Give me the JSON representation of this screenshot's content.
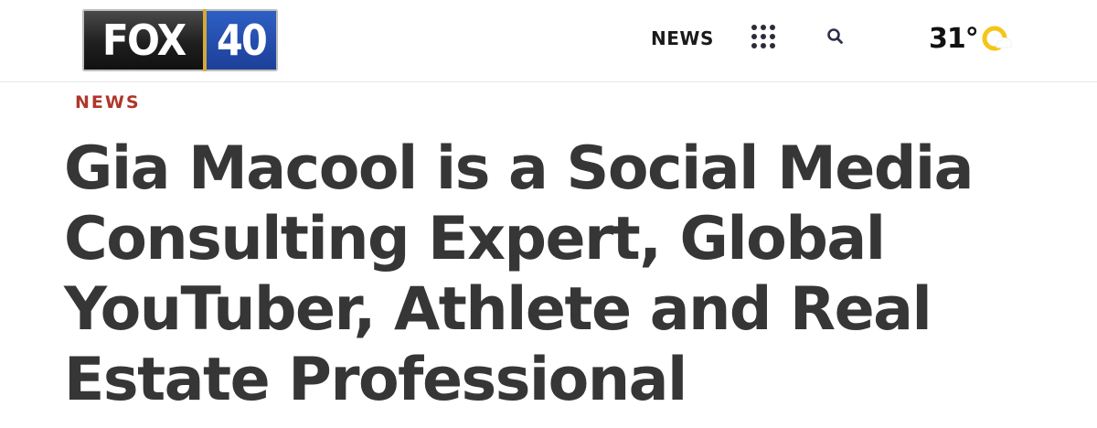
{
  "header": {
    "logo": {
      "left_text": "FOX",
      "right_text": "40",
      "colors": {
        "left_bg": "#1f1f1f",
        "right_bg": "#2d5fc4",
        "divider": "#d4a83a"
      }
    },
    "nav_news_label": "NEWS",
    "menu_icon": "grid-dots-icon",
    "search_icon": "search-icon",
    "weather": {
      "temperature": "31°",
      "icon": "partly-sunny-icon",
      "icon_color": "#f5c518"
    }
  },
  "article": {
    "section": "NEWS",
    "headline": "Gia Macool is a Social Media Consulting Expert, Global YouTuber, Athlete and Real Estate Professional",
    "colors": {
      "section": "#b0362a",
      "headline": "#363636"
    }
  }
}
